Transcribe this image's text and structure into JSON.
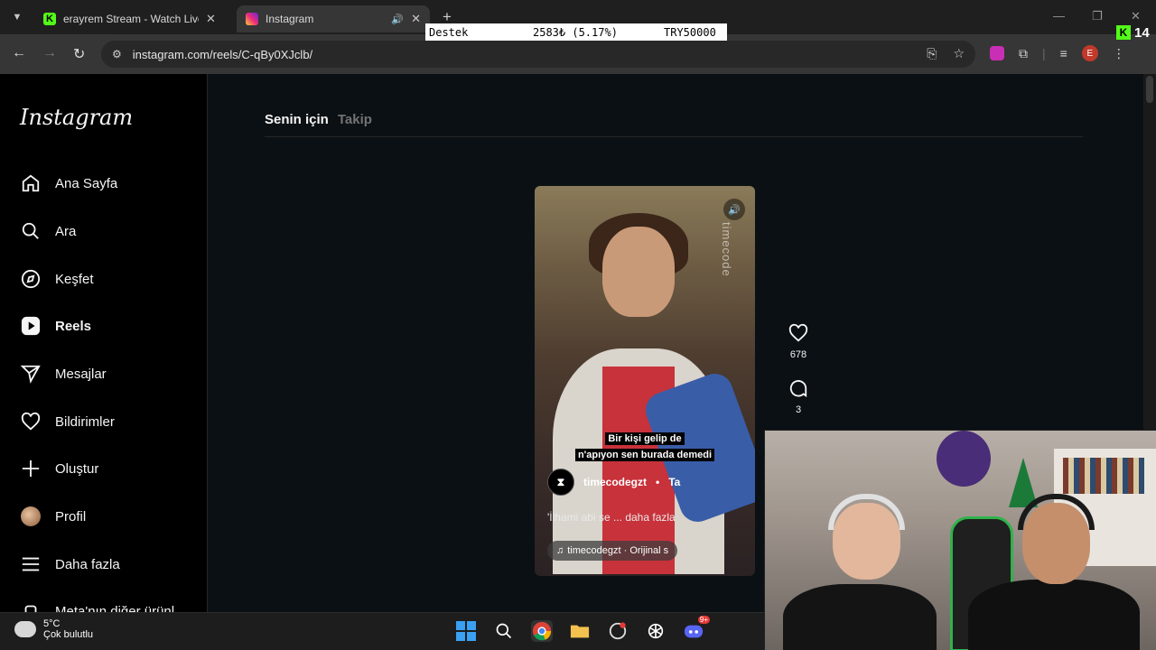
{
  "browser": {
    "tabs": [
      {
        "title": "erayrem Stream - Watch Live o",
        "favicon": "kick-icon"
      },
      {
        "title": "Instagram",
        "favicon": "instagram-icon",
        "active": true
      }
    ],
    "url": "instagram.com/reels/C-qBy0XJclb/",
    "profile_initial": "E"
  },
  "stream_overlay": {
    "ticker": {
      "label": "Destek",
      "amount": "2583₺ (5.17%)",
      "goal": "TRY50000"
    },
    "kick_count": "14"
  },
  "instagram": {
    "logo": "Instagram",
    "nav": [
      {
        "label": "Ana Sayfa",
        "icon": "home-icon"
      },
      {
        "label": "Ara",
        "icon": "search-icon"
      },
      {
        "label": "Keşfet",
        "icon": "compass-icon"
      },
      {
        "label": "Reels",
        "icon": "reels-icon",
        "active": true
      },
      {
        "label": "Mesajlar",
        "icon": "send-icon"
      },
      {
        "label": "Bildirimler",
        "icon": "heart-icon"
      },
      {
        "label": "Oluştur",
        "icon": "plus-icon"
      },
      {
        "label": "Profil",
        "icon": "avatar"
      },
      {
        "label": "Daha fazla",
        "icon": "menu-icon"
      },
      {
        "label": "Meta'nın diğer ürünl",
        "icon": "meta-icon"
      }
    ],
    "feed_tabs": {
      "for_you": "Senin için",
      "following": "Takip"
    },
    "reel": {
      "subtitle_line1": "Bir kişi gelip de",
      "subtitle_line2": "n'apıyon sen burada demedi",
      "watermark": "timecode",
      "author": "timecodegzt",
      "follow_sep": "•",
      "follow": "Ta",
      "caption": "'İlhami abi se",
      "caption_more": "... daha fazla",
      "audio": "timecodegzt · Orijinal s",
      "likes": "678",
      "comments": "3"
    }
  },
  "taskbar": {
    "temperature": "5°C",
    "condition": "Çok bulutlu",
    "discord_badge": "9+"
  }
}
